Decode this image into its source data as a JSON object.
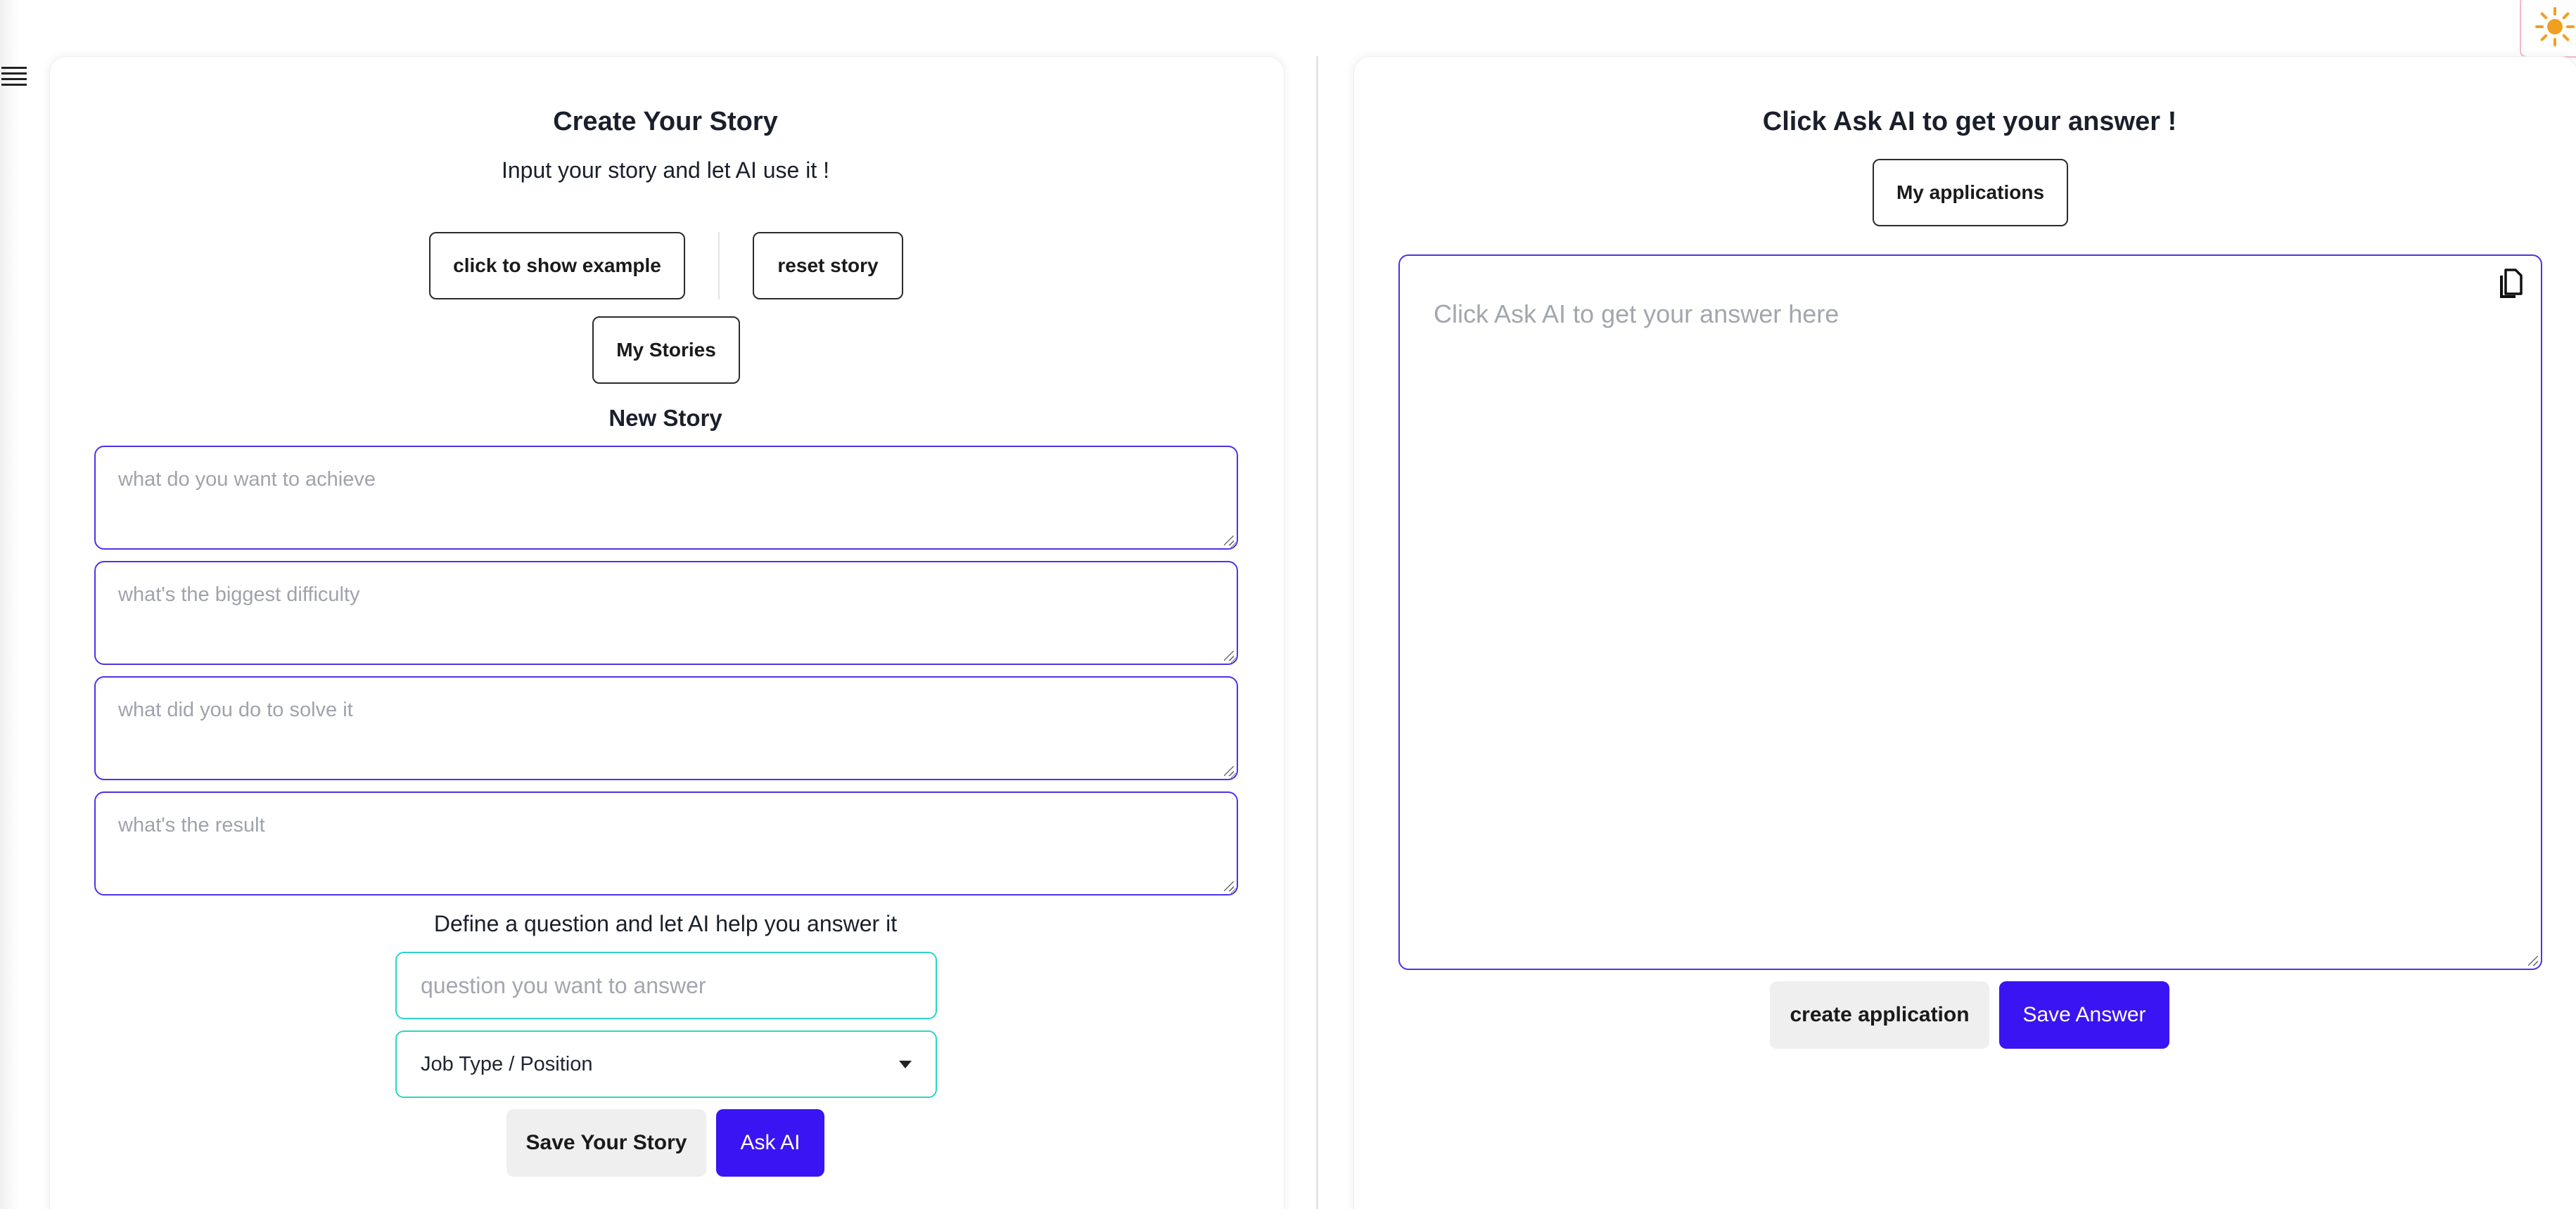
{
  "nav": {
    "menu_icon": "hamburger-menu-icon"
  },
  "theme": {
    "icon": "sun-icon",
    "color": "#f0a020"
  },
  "left": {
    "title": "Create Your Story",
    "subtitle": "Input your story and let AI use it !",
    "show_example_label": "click to show example",
    "reset_label": "reset story",
    "my_stories_label": "My Stories",
    "section_title": "New Story",
    "fields": [
      {
        "placeholder": "what do you want to achieve"
      },
      {
        "placeholder": "what's the biggest difficulty"
      },
      {
        "placeholder": "what did you do to solve it"
      },
      {
        "placeholder": "what's the result"
      }
    ],
    "question_prompt": "Define a question and let AI help you answer it",
    "question_placeholder": "question you want to answer",
    "job_select_value": "Job Type / Position",
    "save_label": "Save Your Story",
    "ask_label": "Ask AI"
  },
  "right": {
    "title": "Click Ask AI to get your answer !",
    "applications_label": "My applications",
    "answer_placeholder": "Click Ask AI to get your answer here",
    "copy_icon": "copy-icon",
    "create_label": "create application",
    "save_answer_label": "Save Answer"
  },
  "colors": {
    "accent": "#3a14f2",
    "input_border": "#4f32e8",
    "teal_border": "#2ad5c8",
    "theme_border": "#f2b8cc"
  }
}
